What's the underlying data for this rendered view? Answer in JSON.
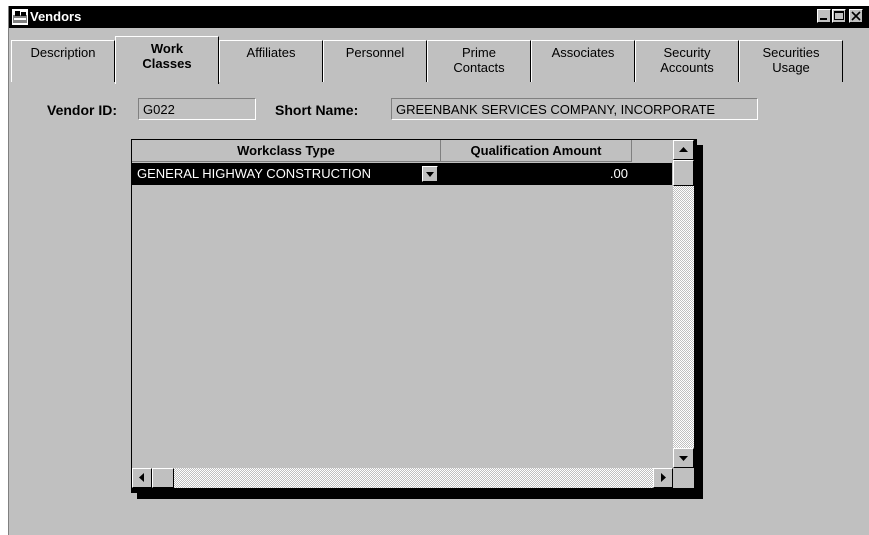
{
  "window": {
    "title": "Vendors",
    "app_icon": "vendors-app-icon",
    "controls": [
      "minimize-icon",
      "maximize-icon",
      "close-icon"
    ]
  },
  "tabs": [
    {
      "line1": "Description",
      "line2": ""
    },
    {
      "line1": "Work",
      "line2": "Classes",
      "active": true
    },
    {
      "line1": "Affiliates",
      "line2": ""
    },
    {
      "line1": "Personnel",
      "line2": ""
    },
    {
      "line1": "Prime",
      "line2": "Contacts"
    },
    {
      "line1": "Associates",
      "line2": ""
    },
    {
      "line1": "Security",
      "line2": "Accounts"
    },
    {
      "line1": "Securities",
      "line2": "Usage"
    }
  ],
  "form": {
    "vendor_id_label": "Vendor ID:",
    "vendor_id_value": "G022",
    "short_name_label": "Short Name:",
    "short_name_value": "GREENBANK SERVICES COMPANY, INCORPORATE"
  },
  "grid": {
    "columns": [
      "Workclass Type",
      "Qualification Amount"
    ],
    "rows": [
      {
        "workclass_type": "GENERAL HIGHWAY CONSTRUCTION",
        "qualification_amount": ".00"
      }
    ]
  },
  "colors": {
    "window_bg": "#c0c0c0",
    "titlebar_bg": "#000000",
    "selected_row_bg": "#000000",
    "selected_row_text": "#ffffff"
  }
}
